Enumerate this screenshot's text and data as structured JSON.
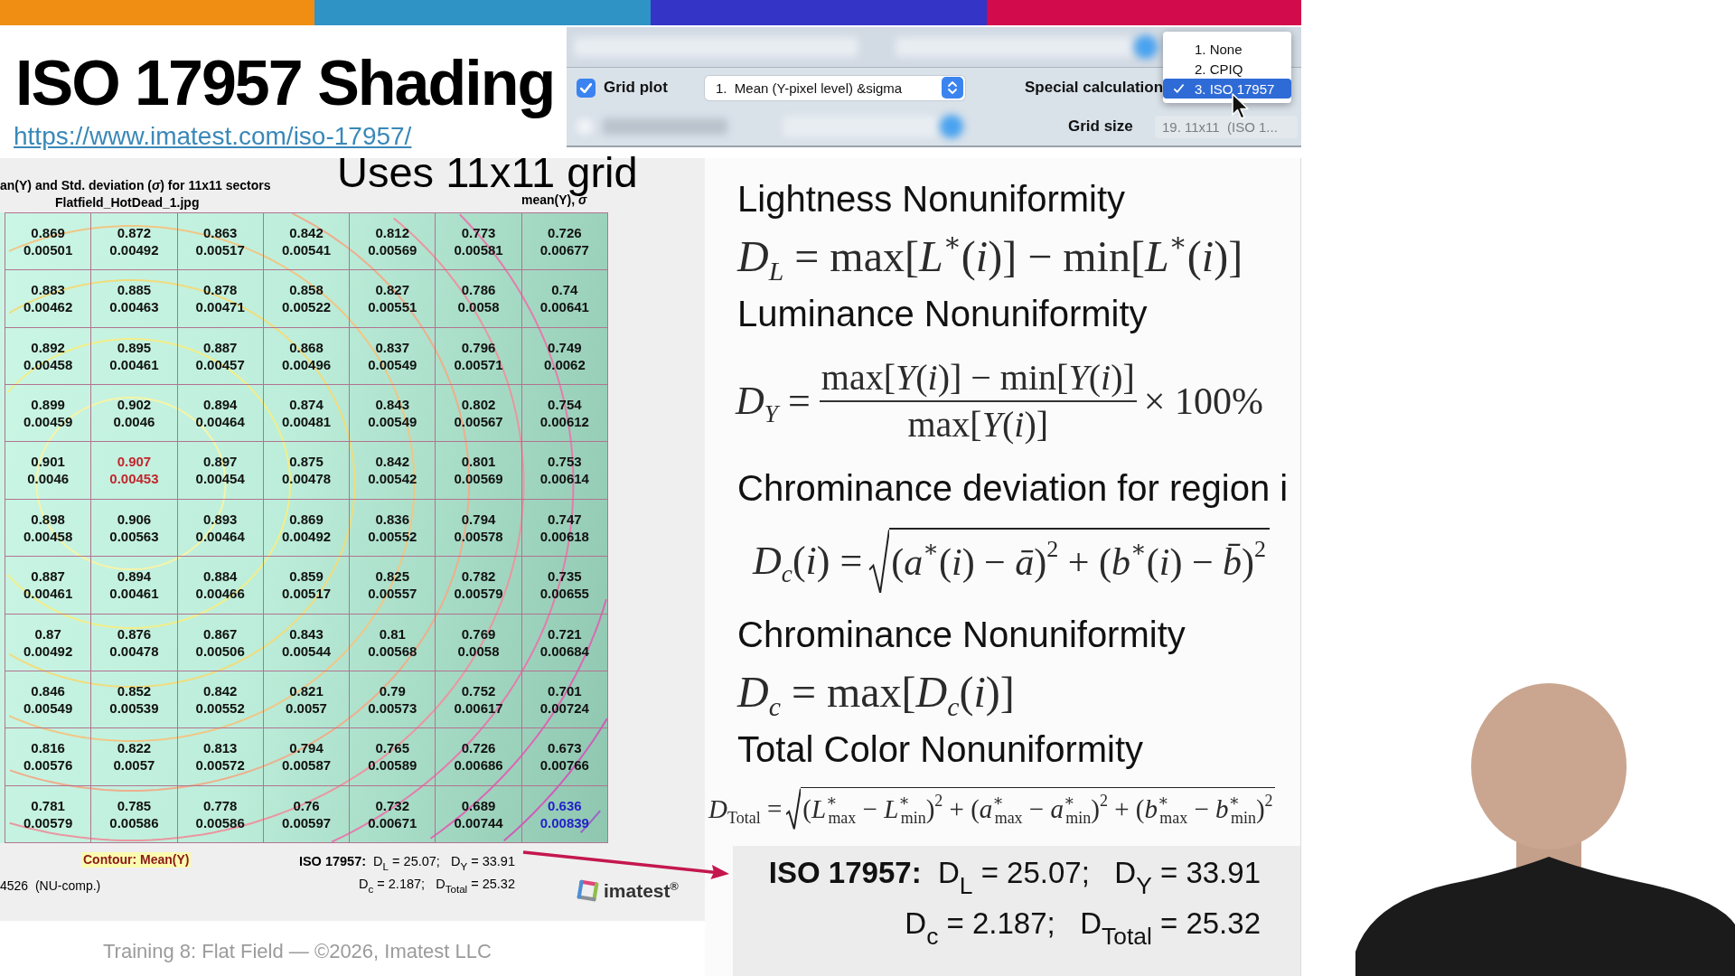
{
  "slide": {
    "title": "ISO 17957 Shading",
    "link": "https://www.imatest.com/iso-17957/",
    "footer": "Training 8: Flat Field — ©2026, Imatest LLC"
  },
  "controls": {
    "grid_plot": {
      "label": "Grid plot",
      "checked": true
    },
    "plot_select": {
      "value": "1.  Mean (Y-pixel level) &sigma"
    },
    "special_calculation": {
      "label": "Special calculation",
      "options": [
        {
          "label": "1. None",
          "selected": false
        },
        {
          "label": "2. CPIQ",
          "selected": false
        },
        {
          "label": "3. ISO 17957",
          "selected": true
        }
      ]
    },
    "grid_size": {
      "label": "Grid size",
      "value": "19. 11x11  (ISO 1..."
    }
  },
  "plot": {
    "annotation": "Uses 11x11 grid",
    "title": "an(Y) and Std. deviation (*σ*) for 11x11 sectors",
    "subtitle": "Flatfield_HotDead_1.jpg",
    "legend": "mean(Y), *σ*",
    "rows": [
      [
        {
          "mean": "0.869",
          "sigma": "0.00501",
          "kind": "normal"
        },
        {
          "mean": "0.872",
          "sigma": "0.00492",
          "kind": "normal"
        },
        {
          "mean": "0.863",
          "sigma": "0.00517",
          "kind": "normal"
        },
        {
          "mean": "0.842",
          "sigma": "0.00541",
          "kind": "normal"
        },
        {
          "mean": "0.812",
          "sigma": "0.00569",
          "kind": "normal"
        },
        {
          "mean": "0.773",
          "sigma": "0.00581",
          "kind": "normal"
        },
        {
          "mean": "0.726",
          "sigma": "0.00677",
          "kind": "normal"
        }
      ],
      [
        {
          "mean": "0.883",
          "sigma": "0.00462",
          "kind": "normal"
        },
        {
          "mean": "0.885",
          "sigma": "0.00463",
          "kind": "normal"
        },
        {
          "mean": "0.878",
          "sigma": "0.00471",
          "kind": "normal"
        },
        {
          "mean": "0.858",
          "sigma": "0.00522",
          "kind": "normal"
        },
        {
          "mean": "0.827",
          "sigma": "0.00551",
          "kind": "normal"
        },
        {
          "mean": "0.786",
          "sigma": "0.0058",
          "kind": "normal"
        },
        {
          "mean": "0.74",
          "sigma": "0.00641",
          "kind": "normal"
        }
      ],
      [
        {
          "mean": "0.892",
          "sigma": "0.00458",
          "kind": "normal"
        },
        {
          "mean": "0.895",
          "sigma": "0.00461",
          "kind": "normal"
        },
        {
          "mean": "0.887",
          "sigma": "0.00457",
          "kind": "normal"
        },
        {
          "mean": "0.868",
          "sigma": "0.00496",
          "kind": "normal"
        },
        {
          "mean": "0.837",
          "sigma": "0.00549",
          "kind": "normal"
        },
        {
          "mean": "0.796",
          "sigma": "0.00571",
          "kind": "normal"
        },
        {
          "mean": "0.749",
          "sigma": "0.0062",
          "kind": "normal"
        }
      ],
      [
        {
          "mean": "0.899",
          "sigma": "0.00459",
          "kind": "normal"
        },
        {
          "mean": "0.902",
          "sigma": "0.0046",
          "kind": "normal"
        },
        {
          "mean": "0.894",
          "sigma": "0.00464",
          "kind": "normal"
        },
        {
          "mean": "0.874",
          "sigma": "0.00481",
          "kind": "normal"
        },
        {
          "mean": "0.843",
          "sigma": "0.00549",
          "kind": "normal"
        },
        {
          "mean": "0.802",
          "sigma": "0.00567",
          "kind": "normal"
        },
        {
          "mean": "0.754",
          "sigma": "0.00612",
          "kind": "normal"
        }
      ],
      [
        {
          "mean": "0.901",
          "sigma": "0.0046",
          "kind": "normal"
        },
        {
          "mean": "0.907",
          "sigma": "0.00453",
          "kind": "max"
        },
        {
          "mean": "0.897",
          "sigma": "0.00454",
          "kind": "normal"
        },
        {
          "mean": "0.875",
          "sigma": "0.00478",
          "kind": "normal"
        },
        {
          "mean": "0.842",
          "sigma": "0.00542",
          "kind": "normal"
        },
        {
          "mean": "0.801",
          "sigma": "0.00569",
          "kind": "normal"
        },
        {
          "mean": "0.753",
          "sigma": "0.00614",
          "kind": "normal"
        }
      ],
      [
        {
          "mean": "0.898",
          "sigma": "0.00458",
          "kind": "normal"
        },
        {
          "mean": "0.906",
          "sigma": "0.00563",
          "kind": "normal"
        },
        {
          "mean": "0.893",
          "sigma": "0.00464",
          "kind": "normal"
        },
        {
          "mean": "0.869",
          "sigma": "0.00492",
          "kind": "normal"
        },
        {
          "mean": "0.836",
          "sigma": "0.00552",
          "kind": "normal"
        },
        {
          "mean": "0.794",
          "sigma": "0.00578",
          "kind": "normal"
        },
        {
          "mean": "0.747",
          "sigma": "0.00618",
          "kind": "normal"
        }
      ],
      [
        {
          "mean": "0.887",
          "sigma": "0.00461",
          "kind": "normal"
        },
        {
          "mean": "0.894",
          "sigma": "0.00461",
          "kind": "normal"
        },
        {
          "mean": "0.884",
          "sigma": "0.00466",
          "kind": "normal"
        },
        {
          "mean": "0.859",
          "sigma": "0.00517",
          "kind": "normal"
        },
        {
          "mean": "0.825",
          "sigma": "0.00557",
          "kind": "normal"
        },
        {
          "mean": "0.782",
          "sigma": "0.00579",
          "kind": "normal"
        },
        {
          "mean": "0.735",
          "sigma": "0.00655",
          "kind": "normal"
        }
      ],
      [
        {
          "mean": "0.87",
          "sigma": "0.00492",
          "kind": "normal"
        },
        {
          "mean": "0.876",
          "sigma": "0.00478",
          "kind": "normal"
        },
        {
          "mean": "0.867",
          "sigma": "0.00506",
          "kind": "normal"
        },
        {
          "mean": "0.843",
          "sigma": "0.00544",
          "kind": "normal"
        },
        {
          "mean": "0.81",
          "sigma": "0.00568",
          "kind": "normal"
        },
        {
          "mean": "0.769",
          "sigma": "0.0058",
          "kind": "normal"
        },
        {
          "mean": "0.721",
          "sigma": "0.00684",
          "kind": "normal"
        }
      ],
      [
        {
          "mean": "0.846",
          "sigma": "0.00549",
          "kind": "normal"
        },
        {
          "mean": "0.852",
          "sigma": "0.00539",
          "kind": "normal"
        },
        {
          "mean": "0.842",
          "sigma": "0.00552",
          "kind": "normal"
        },
        {
          "mean": "0.821",
          "sigma": "0.0057",
          "kind": "normal"
        },
        {
          "mean": "0.79",
          "sigma": "0.00573",
          "kind": "normal"
        },
        {
          "mean": "0.752",
          "sigma": "0.00617",
          "kind": "normal"
        },
        {
          "mean": "0.701",
          "sigma": "0.00724",
          "kind": "normal"
        }
      ],
      [
        {
          "mean": "0.816",
          "sigma": "0.00576",
          "kind": "normal"
        },
        {
          "mean": "0.822",
          "sigma": "0.0057",
          "kind": "normal"
        },
        {
          "mean": "0.813",
          "sigma": "0.00572",
          "kind": "normal"
        },
        {
          "mean": "0.794",
          "sigma": "0.00587",
          "kind": "normal"
        },
        {
          "mean": "0.765",
          "sigma": "0.00589",
          "kind": "normal"
        },
        {
          "mean": "0.726",
          "sigma": "0.00686",
          "kind": "normal"
        },
        {
          "mean": "0.673",
          "sigma": "0.00766",
          "kind": "normal"
        }
      ],
      [
        {
          "mean": "0.781",
          "sigma": "0.00579",
          "kind": "normal"
        },
        {
          "mean": "0.785",
          "sigma": "0.00586",
          "kind": "normal"
        },
        {
          "mean": "0.778",
          "sigma": "0.00586",
          "kind": "normal"
        },
        {
          "mean": "0.76",
          "sigma": "0.00597",
          "kind": "normal"
        },
        {
          "mean": "0.732",
          "sigma": "0.00671",
          "kind": "normal"
        },
        {
          "mean": "0.689",
          "sigma": "0.00744",
          "kind": "normal"
        },
        {
          "mean": "0.636",
          "sigma": "0.00839",
          "kind": "min"
        }
      ]
    ],
    "contour_label": "Contour: Mean(Y)",
    "note": "4526  (NU-comp.)",
    "results": [
      "**ISO 17957:**  D$_{L}$ = 25.07;   D$_{Y}$ = 33.91",
      "D$_{c}$ = 2.187;   D$_{Total}$ = 25.32"
    ],
    "logo": "imatest$^{®}$"
  },
  "formulas": [
    {
      "kind": "heading",
      "text": "Lightness Nonuniformity"
    },
    {
      "kind": "equation",
      "text": "*D*$_{L}$ = max[*L*$^{∗}$(*i*)] − min[*L*$^{∗}$(*i*)]"
    },
    {
      "kind": "heading",
      "text": "Luminance Nonuniformity"
    },
    {
      "kind": "fraction",
      "lhs": "*D*$_{Y}$ =",
      "numerator": "max[*Y*(*i*)] − min[*Y*(*i*)]",
      "denominator": "max[*Y*(*i*)]",
      "rhs": "× 100%"
    },
    {
      "kind": "heading",
      "text": "Chrominance deviation for region i"
    },
    {
      "kind": "root",
      "lhs": "*D*$_{c}$(*i*) =",
      "radicand": "(*a*$^{∗}$(*i*) − *ā*)$^{2}$ + (*b*$^{∗}$(*i*) − *b̄*)$^{2}$"
    },
    {
      "kind": "heading",
      "text": "Chrominance Nonuniformity"
    },
    {
      "kind": "equation",
      "text": "*D*$_{c}$ = max[*D*$_{c}$(*i*)]"
    },
    {
      "kind": "heading",
      "text": "Total Color Nonuniformity"
    },
    {
      "kind": "smallroot",
      "lhs": "*D*$_{Total}$ =",
      "radicand": "(*L*$^{∗}$$_{max}$ − *L*$^{∗}$$_{min}$)$^{2}$ + (*a*$^{∗}$$_{max}$ − *a*$^{∗}$$_{min}$)$^{2}$ + (*b*$^{∗}$$_{max}$ − *b*$^{∗}$$_{min}$)$^{2}$"
    }
  ],
  "results": {
    "lines": [
      "**ISO 17957:**  D$_{L}$ = 25.07;   D$_{Y}$ = 33.91",
      "D$_{c}$ = 2.187;   D$_{Total}$ = 25.32"
    ]
  }
}
